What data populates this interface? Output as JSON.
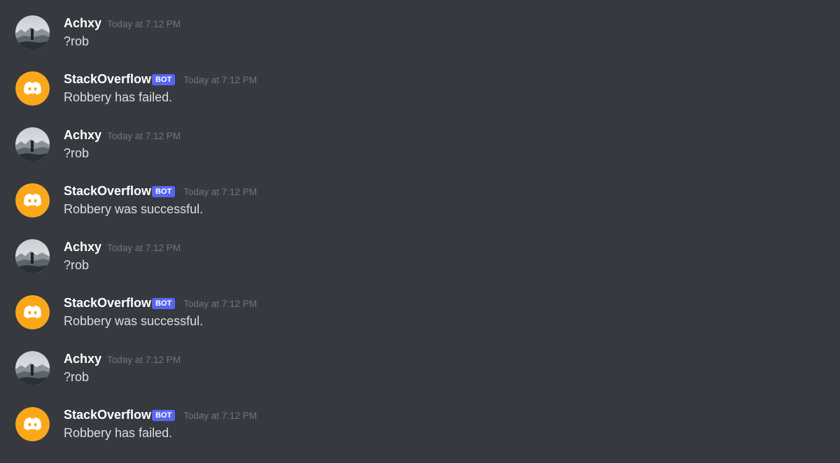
{
  "chat": {
    "messages": [
      {
        "author": "Achxy",
        "type": "user",
        "avatar": "user-avatar",
        "timestamp": "Today at 7:12 PM",
        "content": "?rob"
      },
      {
        "author": "StackOverflow",
        "type": "bot",
        "avatar": "discord-logo-icon",
        "badge": "BOT",
        "timestamp": "Today at 7:12 PM",
        "content": "Robbery has failed."
      },
      {
        "author": "Achxy",
        "type": "user",
        "avatar": "user-avatar",
        "timestamp": "Today at 7:12 PM",
        "content": "?rob"
      },
      {
        "author": "StackOverflow",
        "type": "bot",
        "avatar": "discord-logo-icon",
        "badge": "BOT",
        "timestamp": "Today at 7:12 PM",
        "content": "Robbery was successful."
      },
      {
        "author": "Achxy",
        "type": "user",
        "avatar": "user-avatar",
        "timestamp": "Today at 7:12 PM",
        "content": "?rob"
      },
      {
        "author": "StackOverflow",
        "type": "bot",
        "avatar": "discord-logo-icon",
        "badge": "BOT",
        "timestamp": "Today at 7:12 PM",
        "content": "Robbery was successful."
      },
      {
        "author": "Achxy",
        "type": "user",
        "avatar": "user-avatar",
        "timestamp": "Today at 7:12 PM",
        "content": "?rob"
      },
      {
        "author": "StackOverflow",
        "type": "bot",
        "avatar": "discord-logo-icon",
        "badge": "BOT",
        "timestamp": "Today at 7:12 PM",
        "content": "Robbery has failed."
      }
    ]
  },
  "colors": {
    "background": "#36393f",
    "bot_badge": "#5865f2",
    "bot_avatar": "#faa81a",
    "username": "#ffffff",
    "timestamp": "#72767d",
    "message_text": "#dcddde"
  }
}
